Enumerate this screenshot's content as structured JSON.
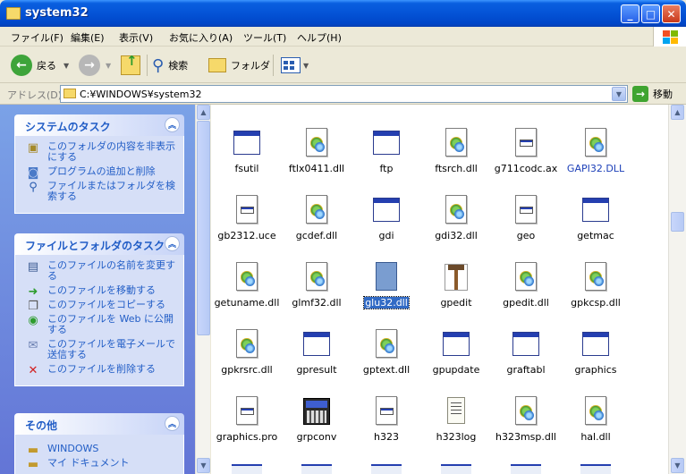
{
  "window": {
    "title": "system32"
  },
  "menu": [
    "ファイル(F)",
    "編集(E)",
    "表示(V)",
    "お気に入り(A)",
    "ツール(T)",
    "ヘルプ(H)"
  ],
  "toolbar": {
    "back": "戻る",
    "search": "検索",
    "folders": "フォルダ"
  },
  "address": {
    "label": "アドレス(D)",
    "path": "C:¥WINDOWS¥system32",
    "go": "移動"
  },
  "tasks": {
    "system": {
      "title": "システムのタスク",
      "items": [
        "このフォルダの内容を非表示にする",
        "プログラムの追加と削除",
        "ファイルまたはフォルダを検索する"
      ]
    },
    "file_folder": {
      "title": "ファイルとフォルダのタスク",
      "items": [
        "このファイルの名前を変更する",
        "このファイルを移動する",
        "このファイルをコピーする",
        "このファイルを Web に公開する",
        "このファイルを電子メールで送信する",
        "このファイルを削除する"
      ]
    },
    "other": {
      "title": "その他",
      "items": [
        "WINDOWS",
        "マイ ドキュメント"
      ]
    }
  },
  "files": [
    {
      "name": "fsutil",
      "icon": "exe"
    },
    {
      "name": "ftlx0411.dll",
      "icon": "dll"
    },
    {
      "name": "ftp",
      "icon": "exe"
    },
    {
      "name": "ftsrch.dll",
      "icon": "dll"
    },
    {
      "name": "g711codc.ax",
      "icon": "ax"
    },
    {
      "name": "GAPI32.DLL",
      "icon": "dll",
      "blue": true
    },
    {
      "name": "gb2312.uce",
      "icon": "uce"
    },
    {
      "name": "gcdef.dll",
      "icon": "dll"
    },
    {
      "name": "gdi",
      "icon": "exe"
    },
    {
      "name": "gdi32.dll",
      "icon": "dll"
    },
    {
      "name": "geo",
      "icon": "uce"
    },
    {
      "name": "getmac",
      "icon": "exe"
    },
    {
      "name": "getuname.dll",
      "icon": "dll"
    },
    {
      "name": "glmf32.dll",
      "icon": "dll"
    },
    {
      "name": "glu32.dll",
      "icon": "dll",
      "selected": true
    },
    {
      "name": "gpedit",
      "icon": "tool"
    },
    {
      "name": "gpedit.dll",
      "icon": "dll"
    },
    {
      "name": "gpkcsp.dll",
      "icon": "dll"
    },
    {
      "name": "gpkrsrc.dll",
      "icon": "dll"
    },
    {
      "name": "gpresult",
      "icon": "exe"
    },
    {
      "name": "gptext.dll",
      "icon": "dll"
    },
    {
      "name": "gpupdate",
      "icon": "exe"
    },
    {
      "name": "graftabl",
      "icon": "exe"
    },
    {
      "name": "graphics",
      "icon": "exe"
    },
    {
      "name": "graphics.pro",
      "icon": "uce"
    },
    {
      "name": "grpconv",
      "icon": "grp"
    },
    {
      "name": "h323",
      "icon": "exe-doc"
    },
    {
      "name": "h323log",
      "icon": "txt"
    },
    {
      "name": "h323msp.dll",
      "icon": "dll"
    },
    {
      "name": "hal.dll",
      "icon": "dll"
    }
  ]
}
